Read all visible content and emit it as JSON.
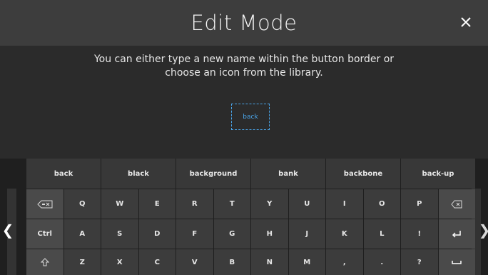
{
  "header": {
    "title": "Edit Mode",
    "close_icon": "close-icon"
  },
  "content": {
    "instruction_line1": "You can either type a new name within the button border or",
    "instruction_line2": "choose an icon from the library.",
    "name_value": "back"
  },
  "suggestions": [
    "back",
    "black",
    "background",
    "bank",
    "backbone",
    "back-up"
  ],
  "keyboard": {
    "row1": [
      "Q",
      "W",
      "E",
      "R",
      "T",
      "Y",
      "U",
      "I",
      "O",
      "P"
    ],
    "row2_ctrl": "Ctrl",
    "row2": [
      "A",
      "S",
      "D",
      "F",
      "G",
      "H",
      "J",
      "K",
      "L",
      "!"
    ],
    "row3": [
      "Z",
      "X",
      "C",
      "V",
      "B",
      "N",
      "M",
      ",",
      ".",
      "?"
    ],
    "left_chevron": "❮",
    "right_chevron": "❯"
  },
  "colors": {
    "accent": "#4aa3e6",
    "title_bar": "#3d3d3d",
    "key": "#3c3c3c"
  }
}
